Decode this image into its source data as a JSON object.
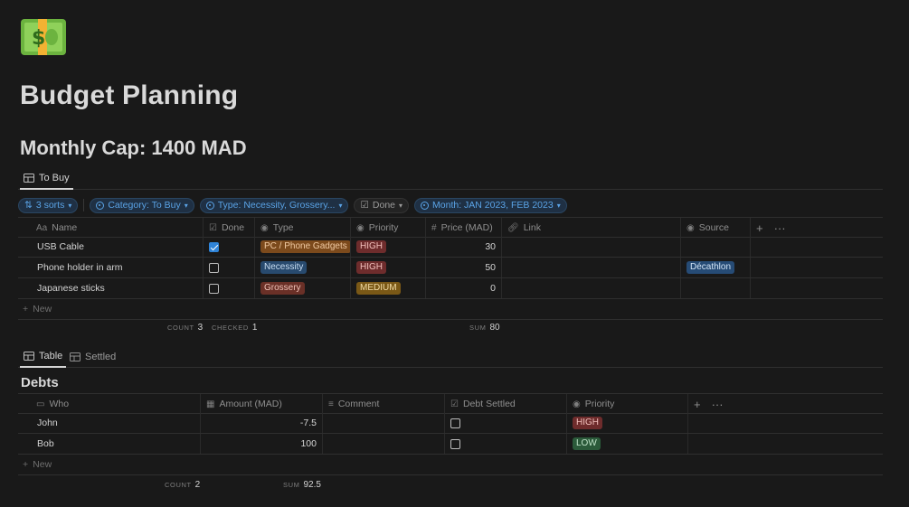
{
  "page": {
    "icon_name": "banknote-icon",
    "title": "Budget Planning",
    "cap_heading": "Monthly Cap: 1400 MAD"
  },
  "to_buy": {
    "tab_label": "To Buy",
    "filters": {
      "sorts": "3 sorts",
      "category": "Category: To Buy",
      "type": "Type: Necessity, Grossery...",
      "done": "Done",
      "month": "Month: JAN 2023, FEB 2023"
    },
    "columns": {
      "name": "Name",
      "done": "Done",
      "type": "Type",
      "priority": "Priority",
      "price": "Price (MAD)",
      "link": "Link",
      "source": "Source"
    },
    "rows": [
      {
        "name": "USB Cable",
        "done": true,
        "type": "PC / Phone Gadgets",
        "type_color": "orange",
        "priority": "HIGH",
        "priority_color": "red",
        "price": "30",
        "link": "",
        "source": ""
      },
      {
        "name": "Phone holder in arm",
        "done": false,
        "type": "Necessity",
        "type_color": "blue",
        "priority": "HIGH",
        "priority_color": "red",
        "price": "50",
        "link": "",
        "source": "Décathlon"
      },
      {
        "name": "Japanese sticks",
        "done": false,
        "type": "Grossery",
        "type_color": "red",
        "priority": "MEDIUM",
        "priority_color": "yellow",
        "price": "0",
        "link": "",
        "source": ""
      }
    ],
    "new_label": "New",
    "calc": {
      "count_label": "COUNT",
      "count": "3",
      "checked_label": "CHECKED",
      "checked": "1",
      "sum_label": "SUM",
      "sum": "80"
    }
  },
  "debts": {
    "tabs": [
      "Table",
      "Settled"
    ],
    "title": "Debts",
    "columns": {
      "who": "Who",
      "amount": "Amount (MAD)",
      "comment": "Comment",
      "settled": "Debt Settled",
      "priority": "Priority"
    },
    "rows": [
      {
        "who": "John",
        "amount": "-7.5",
        "comment": "",
        "settled": false,
        "priority": "HIGH",
        "priority_color": "red"
      },
      {
        "who": "Bob",
        "amount": "100",
        "comment": "",
        "settled": false,
        "priority": "LOW",
        "priority_color": "green"
      }
    ],
    "new_label": "New",
    "calc": {
      "count_label": "COUNT",
      "count": "2",
      "sum_label": "SUM",
      "sum": "92.5"
    }
  },
  "colors": {
    "background": "#191919",
    "accent_blue": "#5aa3e6",
    "checkbox_blue": "#2f84d8"
  }
}
